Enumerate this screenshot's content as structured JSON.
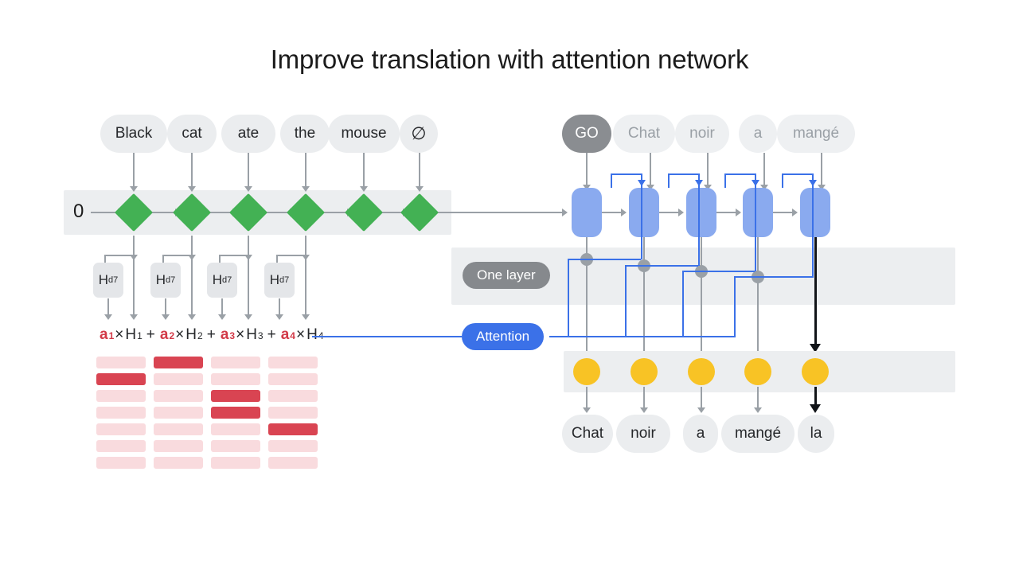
{
  "slide": {
    "title": "Improve translation with attention network",
    "background": "#ffffff"
  },
  "colors": {
    "encoder_node": "#43b154",
    "decoder_node": "#8aaaef",
    "output_node": "#f8c325",
    "attention_line": "#3b71e8",
    "attention_pill": "#3b71e8",
    "layer_pill": "#86898d",
    "band": "#eceef0",
    "heat_high": "#d94452",
    "heat_low": "#fadde0",
    "formula_accent": "#d23a48",
    "wire": "#9aa0a6",
    "highlight_arrow": "#111418"
  },
  "encoder": {
    "init_state_label": "0",
    "input_tokens": [
      "Black",
      "cat",
      "ate",
      "the",
      "mouse",
      "∅"
    ],
    "hidden_boxes": [
      {
        "symbol": "H",
        "subscript": "d7"
      },
      {
        "symbol": "H",
        "subscript": "d7"
      },
      {
        "symbol": "H",
        "subscript": "d7"
      },
      {
        "symbol": "H",
        "subscript": "d7"
      }
    ]
  },
  "formula": {
    "terms": [
      {
        "coef": "a",
        "coef_sub": "1",
        "times": "×",
        "h": "H",
        "h_sub": "1",
        "plus": "+"
      },
      {
        "coef": "a",
        "coef_sub": "2",
        "times": "×",
        "h": "H",
        "h_sub": "2",
        "plus": "+"
      },
      {
        "coef": "a",
        "coef_sub": "3",
        "times": "×",
        "h": "H",
        "h_sub": "3",
        "plus": "+"
      },
      {
        "coef": "a",
        "coef_sub": "4",
        "times": "×",
        "h": "H",
        "h_sub": "4",
        "plus": ""
      }
    ]
  },
  "heatmap": {
    "rows": 7,
    "cols": 4,
    "grid": [
      [
        0.12,
        1.0,
        0.12,
        0.12
      ],
      [
        1.0,
        0.12,
        0.12,
        0.12
      ],
      [
        0.12,
        0.12,
        1.0,
        0.12
      ],
      [
        0.12,
        0.12,
        1.0,
        0.12
      ],
      [
        0.12,
        0.12,
        0.12,
        1.0
      ],
      [
        0.12,
        0.12,
        0.12,
        0.12
      ],
      [
        0.12,
        0.12,
        0.12,
        0.12
      ]
    ]
  },
  "decoder": {
    "input_tokens": [
      {
        "text": "GO",
        "style": "dark"
      },
      {
        "text": "Chat",
        "style": "dim"
      },
      {
        "text": "noir",
        "style": "dim"
      },
      {
        "text": "a",
        "style": "dim"
      },
      {
        "text": "mangé",
        "style": "dim"
      }
    ],
    "output_tokens": [
      "Chat",
      "noir",
      "a",
      "mangé",
      "la"
    ],
    "layer_label": "One layer",
    "attention_label": "Attention"
  }
}
